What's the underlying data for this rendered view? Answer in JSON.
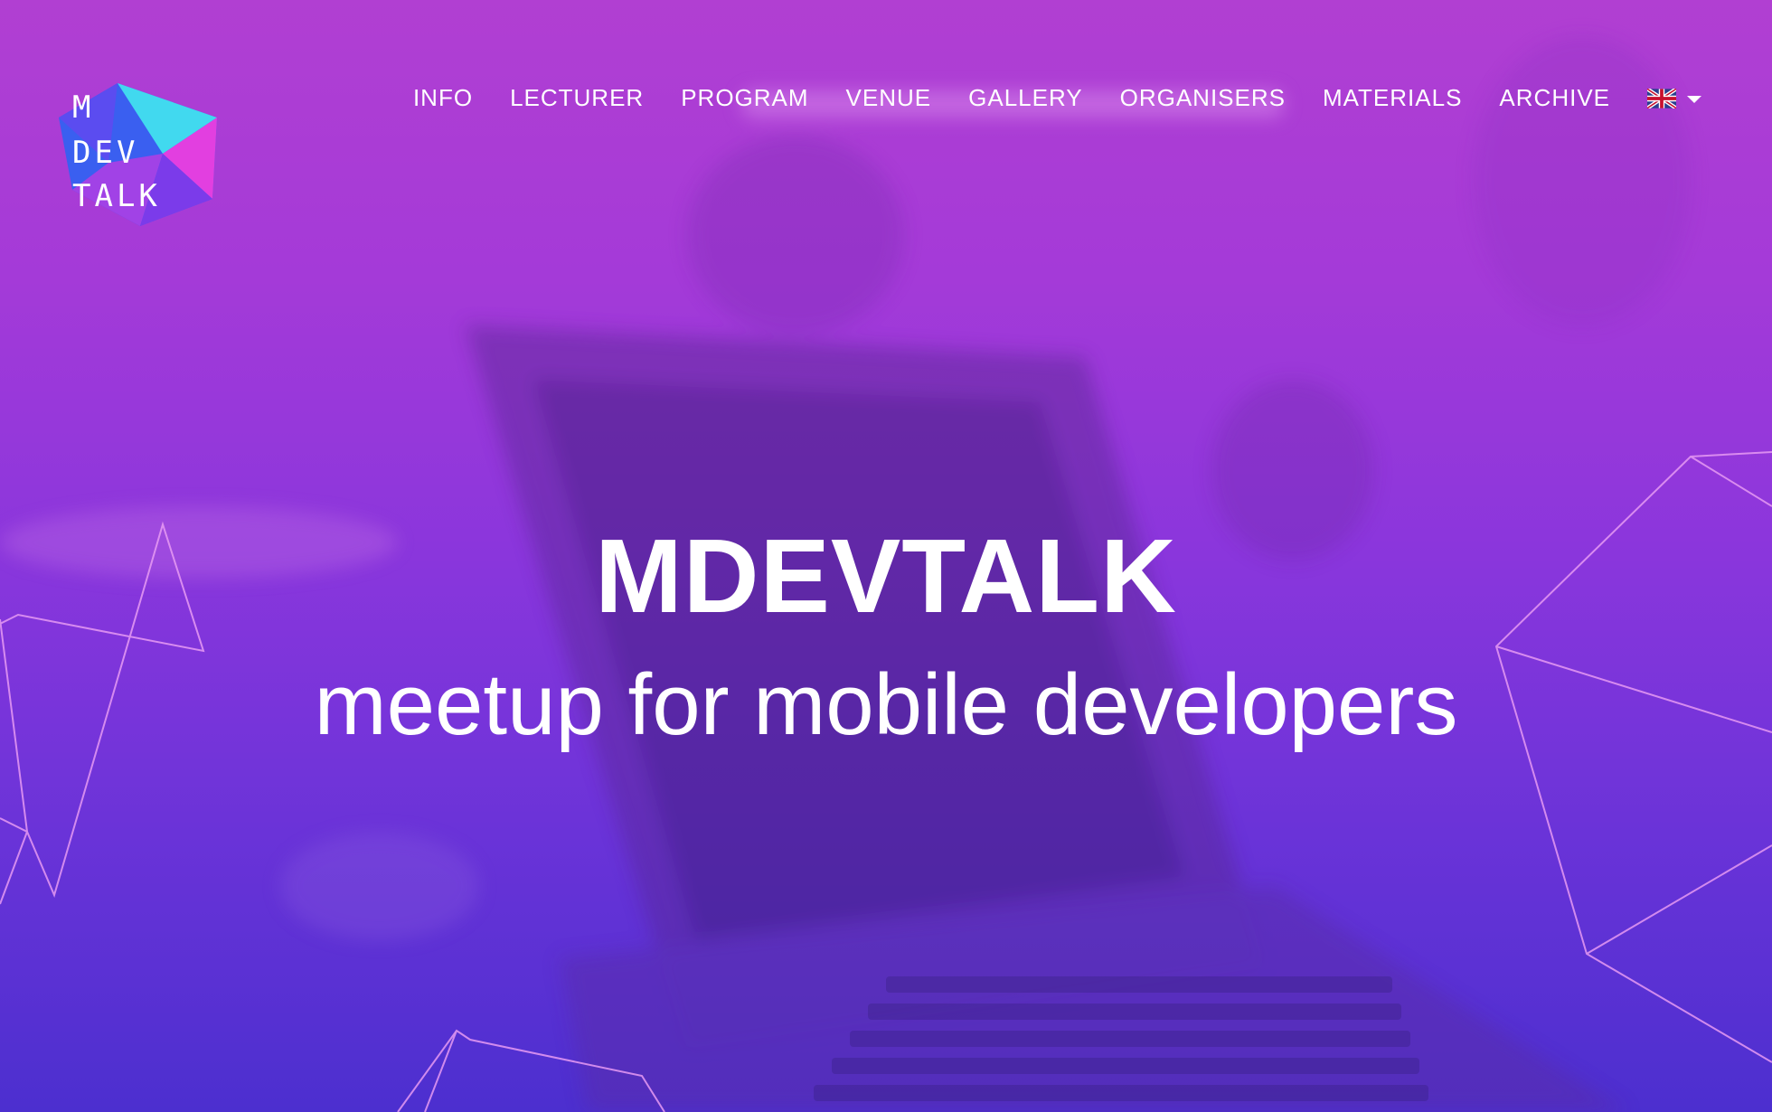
{
  "brand": {
    "logo_lines": [
      "M",
      "DEV",
      "TALK"
    ],
    "colors": {
      "cyan": "#41d9ef",
      "pink": "#e23fe0",
      "blue": "#3a5ff0",
      "purple": "#a142e6"
    }
  },
  "nav": {
    "items": [
      {
        "label": "INFO"
      },
      {
        "label": "LECTURER"
      },
      {
        "label": "PROGRAM"
      },
      {
        "label": "VENUE"
      },
      {
        "label": "GALLERY"
      },
      {
        "label": "ORGANISERS"
      },
      {
        "label": "MATERIALS"
      },
      {
        "label": "ARCHIVE"
      }
    ],
    "language": {
      "icon": "uk-flag-icon",
      "dropdown_icon": "caret-down-icon"
    }
  },
  "hero": {
    "title": "MDEVTALK",
    "subtitle": "meetup for mobile developers"
  },
  "theme": {
    "gradient_top": "#b13fd2",
    "gradient_bottom": "#4c2fcf",
    "line_color": "#e79bf3"
  }
}
